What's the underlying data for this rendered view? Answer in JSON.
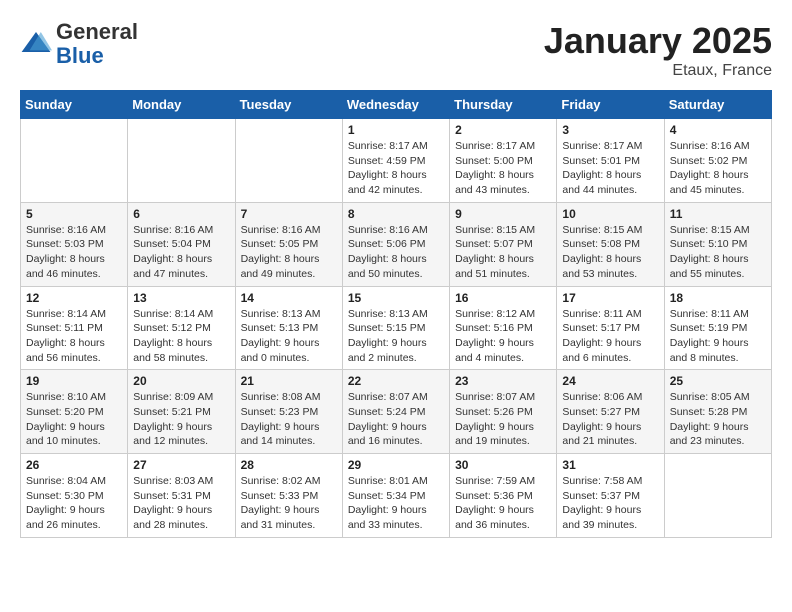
{
  "header": {
    "logo_line1": "General",
    "logo_line2": "Blue",
    "month": "January 2025",
    "location": "Etaux, France"
  },
  "weekdays": [
    "Sunday",
    "Monday",
    "Tuesday",
    "Wednesday",
    "Thursday",
    "Friday",
    "Saturday"
  ],
  "weeks": [
    [
      {
        "day": "",
        "info": ""
      },
      {
        "day": "",
        "info": ""
      },
      {
        "day": "",
        "info": ""
      },
      {
        "day": "1",
        "info": "Sunrise: 8:17 AM\nSunset: 4:59 PM\nDaylight: 8 hours and 42 minutes."
      },
      {
        "day": "2",
        "info": "Sunrise: 8:17 AM\nSunset: 5:00 PM\nDaylight: 8 hours and 43 minutes."
      },
      {
        "day": "3",
        "info": "Sunrise: 8:17 AM\nSunset: 5:01 PM\nDaylight: 8 hours and 44 minutes."
      },
      {
        "day": "4",
        "info": "Sunrise: 8:16 AM\nSunset: 5:02 PM\nDaylight: 8 hours and 45 minutes."
      }
    ],
    [
      {
        "day": "5",
        "info": "Sunrise: 8:16 AM\nSunset: 5:03 PM\nDaylight: 8 hours and 46 minutes."
      },
      {
        "day": "6",
        "info": "Sunrise: 8:16 AM\nSunset: 5:04 PM\nDaylight: 8 hours and 47 minutes."
      },
      {
        "day": "7",
        "info": "Sunrise: 8:16 AM\nSunset: 5:05 PM\nDaylight: 8 hours and 49 minutes."
      },
      {
        "day": "8",
        "info": "Sunrise: 8:16 AM\nSunset: 5:06 PM\nDaylight: 8 hours and 50 minutes."
      },
      {
        "day": "9",
        "info": "Sunrise: 8:15 AM\nSunset: 5:07 PM\nDaylight: 8 hours and 51 minutes."
      },
      {
        "day": "10",
        "info": "Sunrise: 8:15 AM\nSunset: 5:08 PM\nDaylight: 8 hours and 53 minutes."
      },
      {
        "day": "11",
        "info": "Sunrise: 8:15 AM\nSunset: 5:10 PM\nDaylight: 8 hours and 55 minutes."
      }
    ],
    [
      {
        "day": "12",
        "info": "Sunrise: 8:14 AM\nSunset: 5:11 PM\nDaylight: 8 hours and 56 minutes."
      },
      {
        "day": "13",
        "info": "Sunrise: 8:14 AM\nSunset: 5:12 PM\nDaylight: 8 hours and 58 minutes."
      },
      {
        "day": "14",
        "info": "Sunrise: 8:13 AM\nSunset: 5:13 PM\nDaylight: 9 hours and 0 minutes."
      },
      {
        "day": "15",
        "info": "Sunrise: 8:13 AM\nSunset: 5:15 PM\nDaylight: 9 hours and 2 minutes."
      },
      {
        "day": "16",
        "info": "Sunrise: 8:12 AM\nSunset: 5:16 PM\nDaylight: 9 hours and 4 minutes."
      },
      {
        "day": "17",
        "info": "Sunrise: 8:11 AM\nSunset: 5:17 PM\nDaylight: 9 hours and 6 minutes."
      },
      {
        "day": "18",
        "info": "Sunrise: 8:11 AM\nSunset: 5:19 PM\nDaylight: 9 hours and 8 minutes."
      }
    ],
    [
      {
        "day": "19",
        "info": "Sunrise: 8:10 AM\nSunset: 5:20 PM\nDaylight: 9 hours and 10 minutes."
      },
      {
        "day": "20",
        "info": "Sunrise: 8:09 AM\nSunset: 5:21 PM\nDaylight: 9 hours and 12 minutes."
      },
      {
        "day": "21",
        "info": "Sunrise: 8:08 AM\nSunset: 5:23 PM\nDaylight: 9 hours and 14 minutes."
      },
      {
        "day": "22",
        "info": "Sunrise: 8:07 AM\nSunset: 5:24 PM\nDaylight: 9 hours and 16 minutes."
      },
      {
        "day": "23",
        "info": "Sunrise: 8:07 AM\nSunset: 5:26 PM\nDaylight: 9 hours and 19 minutes."
      },
      {
        "day": "24",
        "info": "Sunrise: 8:06 AM\nSunset: 5:27 PM\nDaylight: 9 hours and 21 minutes."
      },
      {
        "day": "25",
        "info": "Sunrise: 8:05 AM\nSunset: 5:28 PM\nDaylight: 9 hours and 23 minutes."
      }
    ],
    [
      {
        "day": "26",
        "info": "Sunrise: 8:04 AM\nSunset: 5:30 PM\nDaylight: 9 hours and 26 minutes."
      },
      {
        "day": "27",
        "info": "Sunrise: 8:03 AM\nSunset: 5:31 PM\nDaylight: 9 hours and 28 minutes."
      },
      {
        "day": "28",
        "info": "Sunrise: 8:02 AM\nSunset: 5:33 PM\nDaylight: 9 hours and 31 minutes."
      },
      {
        "day": "29",
        "info": "Sunrise: 8:01 AM\nSunset: 5:34 PM\nDaylight: 9 hours and 33 minutes."
      },
      {
        "day": "30",
        "info": "Sunrise: 7:59 AM\nSunset: 5:36 PM\nDaylight: 9 hours and 36 minutes."
      },
      {
        "day": "31",
        "info": "Sunrise: 7:58 AM\nSunset: 5:37 PM\nDaylight: 9 hours and 39 minutes."
      },
      {
        "day": "",
        "info": ""
      }
    ]
  ]
}
